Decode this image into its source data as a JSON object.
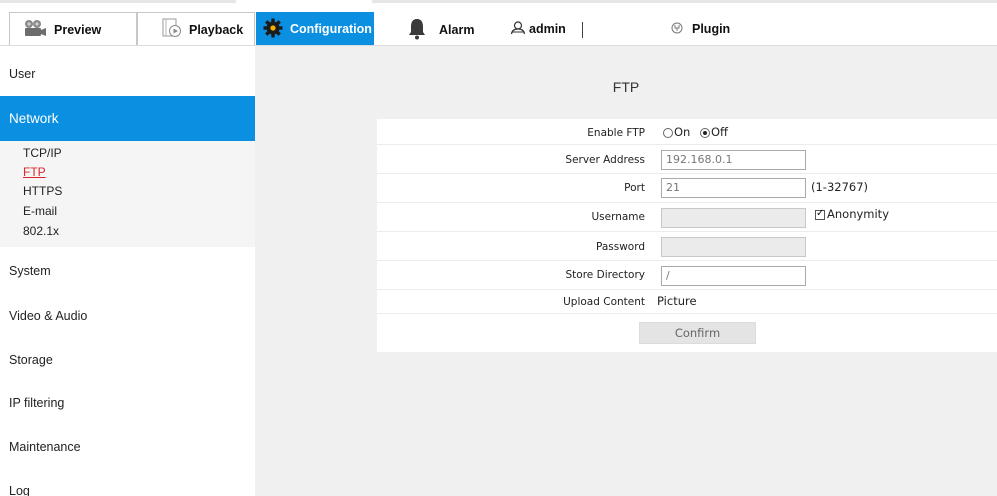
{
  "nav": {
    "tabs": [
      {
        "label": "Preview",
        "icon": "preview-camera-icon"
      },
      {
        "label": "Playback",
        "icon": "playback-film-icon"
      },
      {
        "label": "Configuration",
        "icon": "gear-icon"
      },
      {
        "label": "Alarm",
        "icon": "bell-icon"
      }
    ],
    "user": "admin",
    "plugin": "Plugin",
    "active_color": "#0b8fe0"
  },
  "sidebar": {
    "items": [
      "User",
      "Network",
      "System",
      "Video & Audio",
      "Storage",
      "IP filtering",
      "Maintenance",
      "Log"
    ],
    "active": "Network",
    "network_sub": [
      "TCP/IP",
      "FTP",
      "HTTPS",
      "E-mail",
      "802.1x"
    ],
    "active_sub": "FTP"
  },
  "ftp": {
    "title": "FTP",
    "enable_label": "Enable FTP",
    "on_label": "On",
    "off_label": "Off",
    "enabled": false,
    "server_label": "Server Address",
    "server_value": "192.168.0.1",
    "port_label": "Port",
    "port_value": "21",
    "port_range": "(1-32767)",
    "username_label": "Username",
    "username_value": "",
    "anonymity_label": "Anonymity",
    "anonymity_checked": true,
    "password_label": "Password",
    "password_value": "",
    "store_label": "Store Directory",
    "store_value": "/",
    "upload_label": "Upload Content",
    "upload_value": "Picture",
    "confirm_label": "Confirm"
  }
}
